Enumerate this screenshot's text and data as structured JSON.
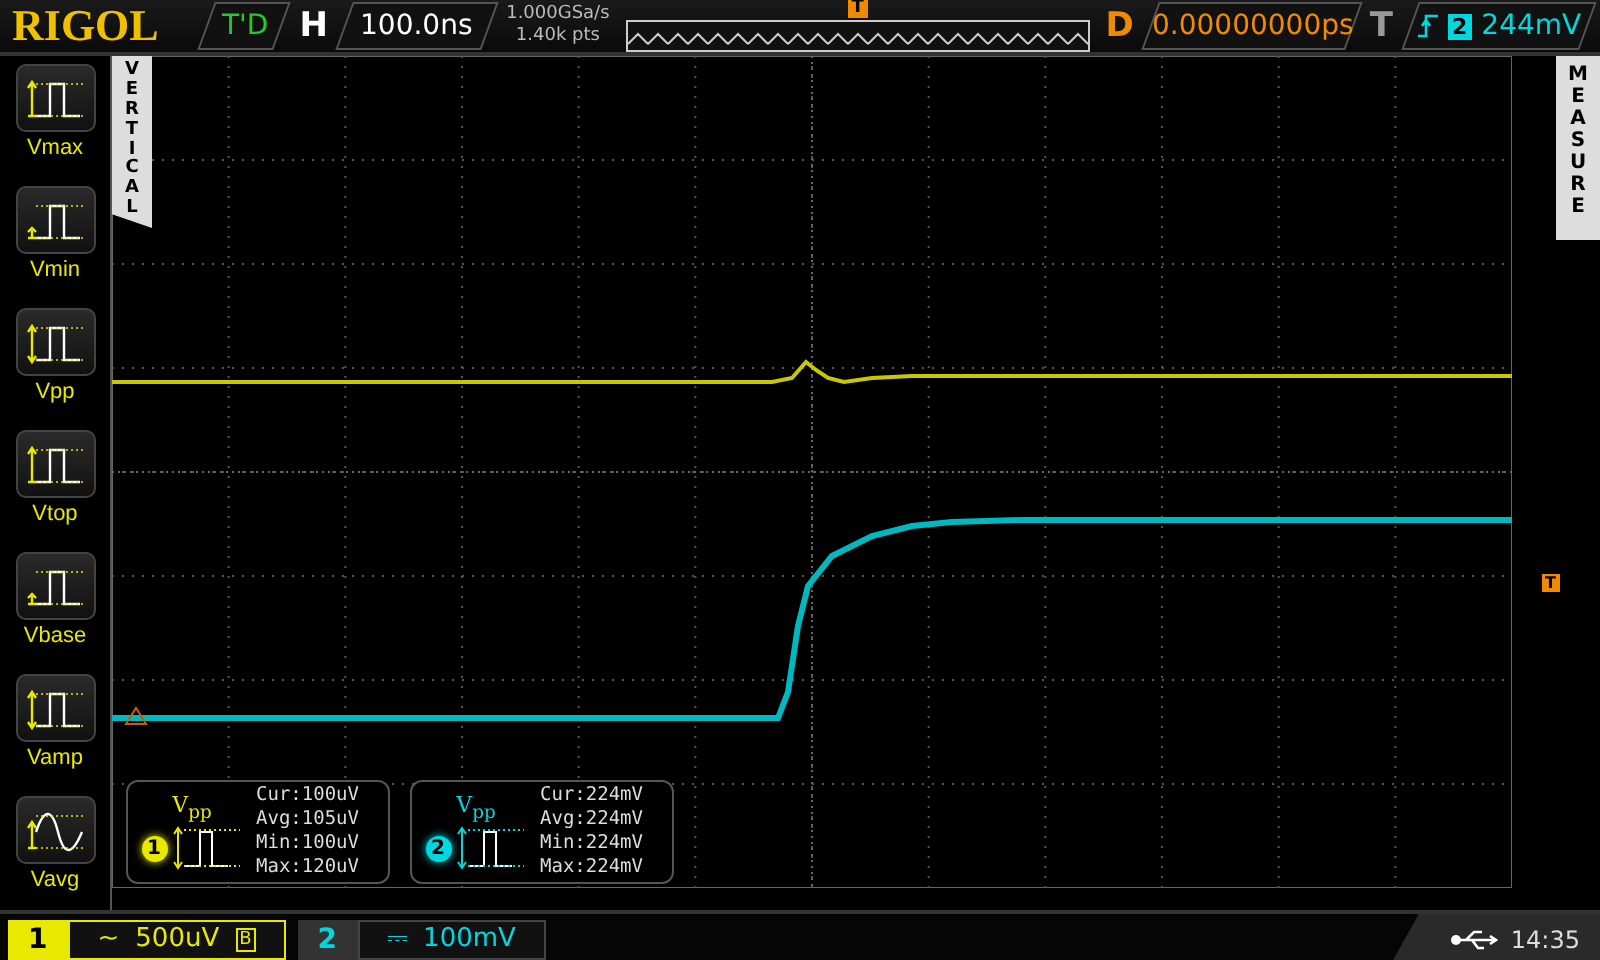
{
  "header": {
    "brand": "RIGOL",
    "status": "T'D",
    "h_label": "H",
    "timebase": "100.0ns",
    "sample_rate": "1.000GSa/s",
    "memory_depth": "1.40k pts",
    "trigger_position_marker": "T",
    "delay_label": "D",
    "delay": "0.00000000ps",
    "trigger_label": "T",
    "trigger_source": "2",
    "trigger_level": "244mV"
  },
  "vertical_tab": "VERTICAL",
  "measure_tab": "MEASURE",
  "measure_items": [
    {
      "label": "Vmax",
      "kind": "max"
    },
    {
      "label": "Vmin",
      "kind": "min"
    },
    {
      "label": "Vpp",
      "kind": "pp"
    },
    {
      "label": "Vtop",
      "kind": "top"
    },
    {
      "label": "Vbase",
      "kind": "base"
    },
    {
      "label": "Vamp",
      "kind": "amp"
    },
    {
      "label": "Vavg",
      "kind": "avg"
    }
  ],
  "trigger_level_marker": "T",
  "readouts": [
    {
      "channel": "1",
      "color": "#e8e800",
      "title": "V$_{pp}$",
      "lines": [
        "Cur:100uV",
        "Avg:105uV",
        "Min:100uV",
        "Max:120uV"
      ]
    },
    {
      "channel": "2",
      "color": "#00d8e0",
      "title": "V$_{pp}$",
      "lines": [
        "Cur:224mV",
        "Avg:224mV",
        "Min:224mV",
        "Max:224mV"
      ]
    }
  ],
  "channels": [
    {
      "number": "1",
      "coupling": "~",
      "scale": "500uV",
      "bw_limit": "B",
      "color": "#e8e800",
      "selected": true
    },
    {
      "number": "2",
      "coupling": "⎓",
      "scale": "100mV",
      "color": "#00d8e0",
      "selected": false
    }
  ],
  "clock": "14:35"
}
